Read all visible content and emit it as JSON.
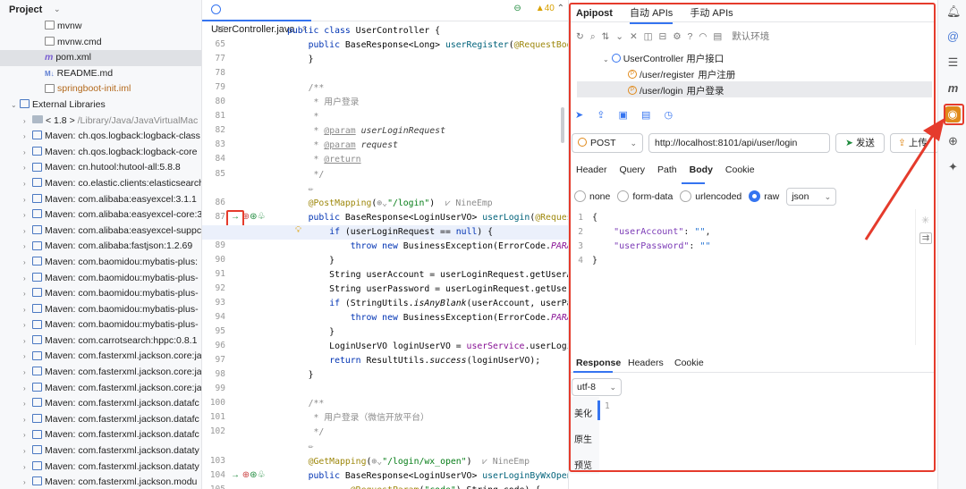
{
  "project": {
    "title": "Project",
    "items": [
      {
        "label": "mvnw",
        "kind": "doc",
        "indent": 40,
        "arrow": ""
      },
      {
        "label": "mvnw.cmd",
        "kind": "doc",
        "indent": 40,
        "arrow": ""
      },
      {
        "label": "pom.xml",
        "kind": "maven",
        "indent": 40,
        "arrow": "",
        "selected": true
      },
      {
        "label": "README.md",
        "kind": "md",
        "indent": 40,
        "arrow": ""
      },
      {
        "label": "springboot-init.iml",
        "kind": "doc",
        "indent": 40,
        "arrow": "",
        "orange": true
      },
      {
        "label": "External Libraries",
        "kind": "libs",
        "indent": 12,
        "arrow": "⌄"
      },
      {
        "label": "< 1.8 >",
        "suffix": " /Library/Java/JavaVirtualMac",
        "kind": "folder",
        "indent": 26,
        "arrow": "›"
      },
      {
        "label": "Maven: ch.qos.logback:logback-class",
        "kind": "lib",
        "indent": 26,
        "arrow": "›"
      },
      {
        "label": "Maven: ch.qos.logback:logback-core",
        "kind": "lib",
        "indent": 26,
        "arrow": "›"
      },
      {
        "label": "Maven: cn.hutool:hutool-all:5.8.8",
        "kind": "lib",
        "indent": 26,
        "arrow": "›"
      },
      {
        "label": "Maven: co.elastic.clients:elasticsearch",
        "kind": "lib",
        "indent": 26,
        "arrow": "›"
      },
      {
        "label": "Maven: com.alibaba:easyexcel:3.1.1",
        "kind": "lib",
        "indent": 26,
        "arrow": "›"
      },
      {
        "label": "Maven: com.alibaba:easyexcel-core:3",
        "kind": "lib",
        "indent": 26,
        "arrow": "›"
      },
      {
        "label": "Maven: com.alibaba:easyexcel-suppc",
        "kind": "lib",
        "indent": 26,
        "arrow": "›"
      },
      {
        "label": "Maven: com.alibaba:fastjson:1.2.69",
        "kind": "lib",
        "indent": 26,
        "arrow": "›"
      },
      {
        "label": "Maven: com.baomidou:mybatis-plus:",
        "kind": "lib",
        "indent": 26,
        "arrow": "›"
      },
      {
        "label": "Maven: com.baomidou:mybatis-plus-",
        "kind": "lib",
        "indent": 26,
        "arrow": "›"
      },
      {
        "label": "Maven: com.baomidou:mybatis-plus-",
        "kind": "lib",
        "indent": 26,
        "arrow": "›"
      },
      {
        "label": "Maven: com.baomidou:mybatis-plus-",
        "kind": "lib",
        "indent": 26,
        "arrow": "›"
      },
      {
        "label": "Maven: com.baomidou:mybatis-plus-",
        "kind": "lib",
        "indent": 26,
        "arrow": "›"
      },
      {
        "label": "Maven: com.carrotsearch:hppc:0.8.1",
        "kind": "lib",
        "indent": 26,
        "arrow": "›"
      },
      {
        "label": "Maven: com.fasterxml.jackson.core:ja",
        "kind": "lib",
        "indent": 26,
        "arrow": "›"
      },
      {
        "label": "Maven: com.fasterxml.jackson.core:ja",
        "kind": "lib",
        "indent": 26,
        "arrow": "›"
      },
      {
        "label": "Maven: com.fasterxml.jackson.core:ja",
        "kind": "lib",
        "indent": 26,
        "arrow": "›"
      },
      {
        "label": "Maven: com.fasterxml.jackson.datafc",
        "kind": "lib",
        "indent": 26,
        "arrow": "›"
      },
      {
        "label": "Maven: com.fasterxml.jackson.datafc",
        "kind": "lib",
        "indent": 26,
        "arrow": "›"
      },
      {
        "label": "Maven: com.fasterxml.jackson.datafc",
        "kind": "lib",
        "indent": 26,
        "arrow": "›"
      },
      {
        "label": "Maven: com.fasterxml.jackson.dataty",
        "kind": "lib",
        "indent": 26,
        "arrow": "›"
      },
      {
        "label": "Maven: com.fasterxml.jackson.dataty",
        "kind": "lib",
        "indent": 26,
        "arrow": "›"
      },
      {
        "label": "Maven: com.fasterxml.jackson.modu",
        "kind": "lib",
        "indent": 26,
        "arrow": "›"
      }
    ]
  },
  "editor": {
    "tab_label": "UserController.java",
    "tab_close": "×",
    "warnings": "▲40",
    "lines": [
      {
        "n": "48",
        "html": "<span class=\"kw\">public class</span> UserController {"
      },
      {
        "n": "65",
        "html": "    <span class=\"kw\">public</span> BaseResponse&lt;Long&gt; <span class=\"mt\">userRegister</span>(<span class=\"an\">@RequestBod</span>"
      },
      {
        "n": "77",
        "html": "    }"
      },
      {
        "n": "78",
        "html": ""
      },
      {
        "n": "79",
        "html": "    <span class=\"cmn\">/**</span>"
      },
      {
        "n": "80",
        "html": "<span class=\"cmn\">     * 用户登录</span>"
      },
      {
        "n": "81",
        "html": "<span class=\"cmn\">     *</span>"
      },
      {
        "n": "82",
        "html": "<span class=\"cmn\">     * </span><span class=\"doctag\">@param</span> <span class=\"docpar\">userLoginRequest</span>"
      },
      {
        "n": "83",
        "html": "<span class=\"cmn\">     * </span><span class=\"doctag\">@param</span> <span class=\"docpar\">request</span>"
      },
      {
        "n": "84",
        "html": "<span class=\"cmn\">     * </span><span class=\"doctag\">@return</span>"
      },
      {
        "n": "85",
        "html": "<span class=\"cmn\">     */</span>"
      },
      {
        "n": "",
        "html": "<span class=\"cmn\">    ✏</span>"
      },
      {
        "n": "86",
        "html": "    <span class=\"an\">@PostMapping</span>(<span class=\"cmn\">⊕⌄</span><span class=\"str\">\"/login\"</span>)  <span class=\"cmn\">⩗ NineEmp</span>"
      },
      {
        "n": "87",
        "html": "    <span class=\"kw\">public</span> BaseResponse&lt;LoginUserVO&gt; <span class=\"mt\">userLogin</span>(<span class=\"an\">@Request</span>"
      },
      {
        "n": "88",
        "html": "        <span class=\"kw\">if</span> (userLoginRequest == <span class=\"kw\">null</span>) {",
        "hl": true
      },
      {
        "n": "89",
        "html": "            <span class=\"kw\">throw new</span> BusinessException(ErrorCode.<span class=\"pf\">PARAM</span>"
      },
      {
        "n": "90",
        "html": "        }"
      },
      {
        "n": "91",
        "html": "        String userAccount = userLoginRequest.getUserAc"
      },
      {
        "n": "92",
        "html": "        String userPassword = userLoginRequest.getUserP"
      },
      {
        "n": "93",
        "html": "        <span class=\"kw\">if</span> (StringUtils.<span class=\"pf\" style=\"color:#080808\">isAnyBlank</span>(userAccount, userPas"
      },
      {
        "n": "94",
        "html": "            <span class=\"kw\">throw new</span> BusinessException(ErrorCode.<span class=\"pf\">PARAM</span>"
      },
      {
        "n": "95",
        "html": "        }"
      },
      {
        "n": "96",
        "html": "        LoginUserVO loginUserVO = <span class=\"pf\" style=\"font-style:normal\">userService</span>.userLogin"
      },
      {
        "n": "97",
        "html": "        <span class=\"kw\">return</span> ResultUtils.<span class=\"pf\" style=\"color:#080808\">success</span>(loginUserVO);"
      },
      {
        "n": "98",
        "html": "    }"
      },
      {
        "n": "99",
        "html": ""
      },
      {
        "n": "100",
        "html": "    <span class=\"cmn\">/**</span>"
      },
      {
        "n": "101",
        "html": "<span class=\"cmn\">     * 用户登录（微信开放平台）</span>"
      },
      {
        "n": "102",
        "html": "<span class=\"cmn\">     */</span>"
      },
      {
        "n": "",
        "html": "<span class=\"cmn\">    ✏</span>"
      },
      {
        "n": "103",
        "html": "    <span class=\"an\">@GetMapping</span>(<span class=\"cmn\">⊕⌄</span><span class=\"str\">\"/login/wx_open\"</span>)  <span class=\"cmn\">⩗ NineEmp</span>"
      },
      {
        "n": "104",
        "html": "    <span class=\"kw\">public</span> BaseResponse&lt;LoginUserVO&gt; <span class=\"mt\">userLoginByWxOpen</span>("
      },
      {
        "n": "105",
        "html": "            <span class=\"an\">@RequestParam</span>(<span class=\"str\">\"code\"</span>) String code) {"
      }
    ]
  },
  "apipost": {
    "tabs": [
      "Apipost",
      "自动 APIs",
      "手动 APIs"
    ],
    "toolbar_icons": "↻ ⌕ ⇅ ⌄ ✕ ◫ ⊟ ⚙ ? ◠ ▤",
    "env_label": "默认环境",
    "tree": {
      "controller": "UserController  用户接口",
      "endpoints": [
        {
          "path": "/user/register",
          "desc": "用户注册"
        },
        {
          "path": "/user/login",
          "desc": "用户登录",
          "selected": true
        }
      ]
    },
    "action_icons": "➤ ⇪ ▣ ▤ ◷",
    "method": "POST",
    "url": "http://localhost:8101/api/user/login",
    "send_label": "发送",
    "upload_label": "上传",
    "subtabs": [
      "Header",
      "Query",
      "Path",
      "Body",
      "Cookie"
    ],
    "active_subtab": "Body",
    "body_types": [
      "none",
      "form-data",
      "urlencoded",
      "raw"
    ],
    "selected_body_type": "raw",
    "format": "json",
    "body_lines": [
      {
        "n": "1",
        "html": "{"
      },
      {
        "n": "2",
        "html": "    <span class=\"jk\">\"userAccount\"</span>: <span class=\"js\">\"\"</span>,"
      },
      {
        "n": "3",
        "html": "    <span class=\"jk\">\"userPassword\"</span>: <span class=\"js\">\"\"</span>"
      },
      {
        "n": "4",
        "html": "}"
      }
    ],
    "response_tabs": [
      "Response",
      "Headers",
      "Cookie"
    ],
    "encoding": "utf-8",
    "view_modes": [
      "美化",
      "原生",
      "预览"
    ],
    "response_line": "1"
  },
  "colors": {
    "accent": "#3574f0",
    "highlight": "#e53b2c",
    "apipost_orange": "#e0891a"
  }
}
